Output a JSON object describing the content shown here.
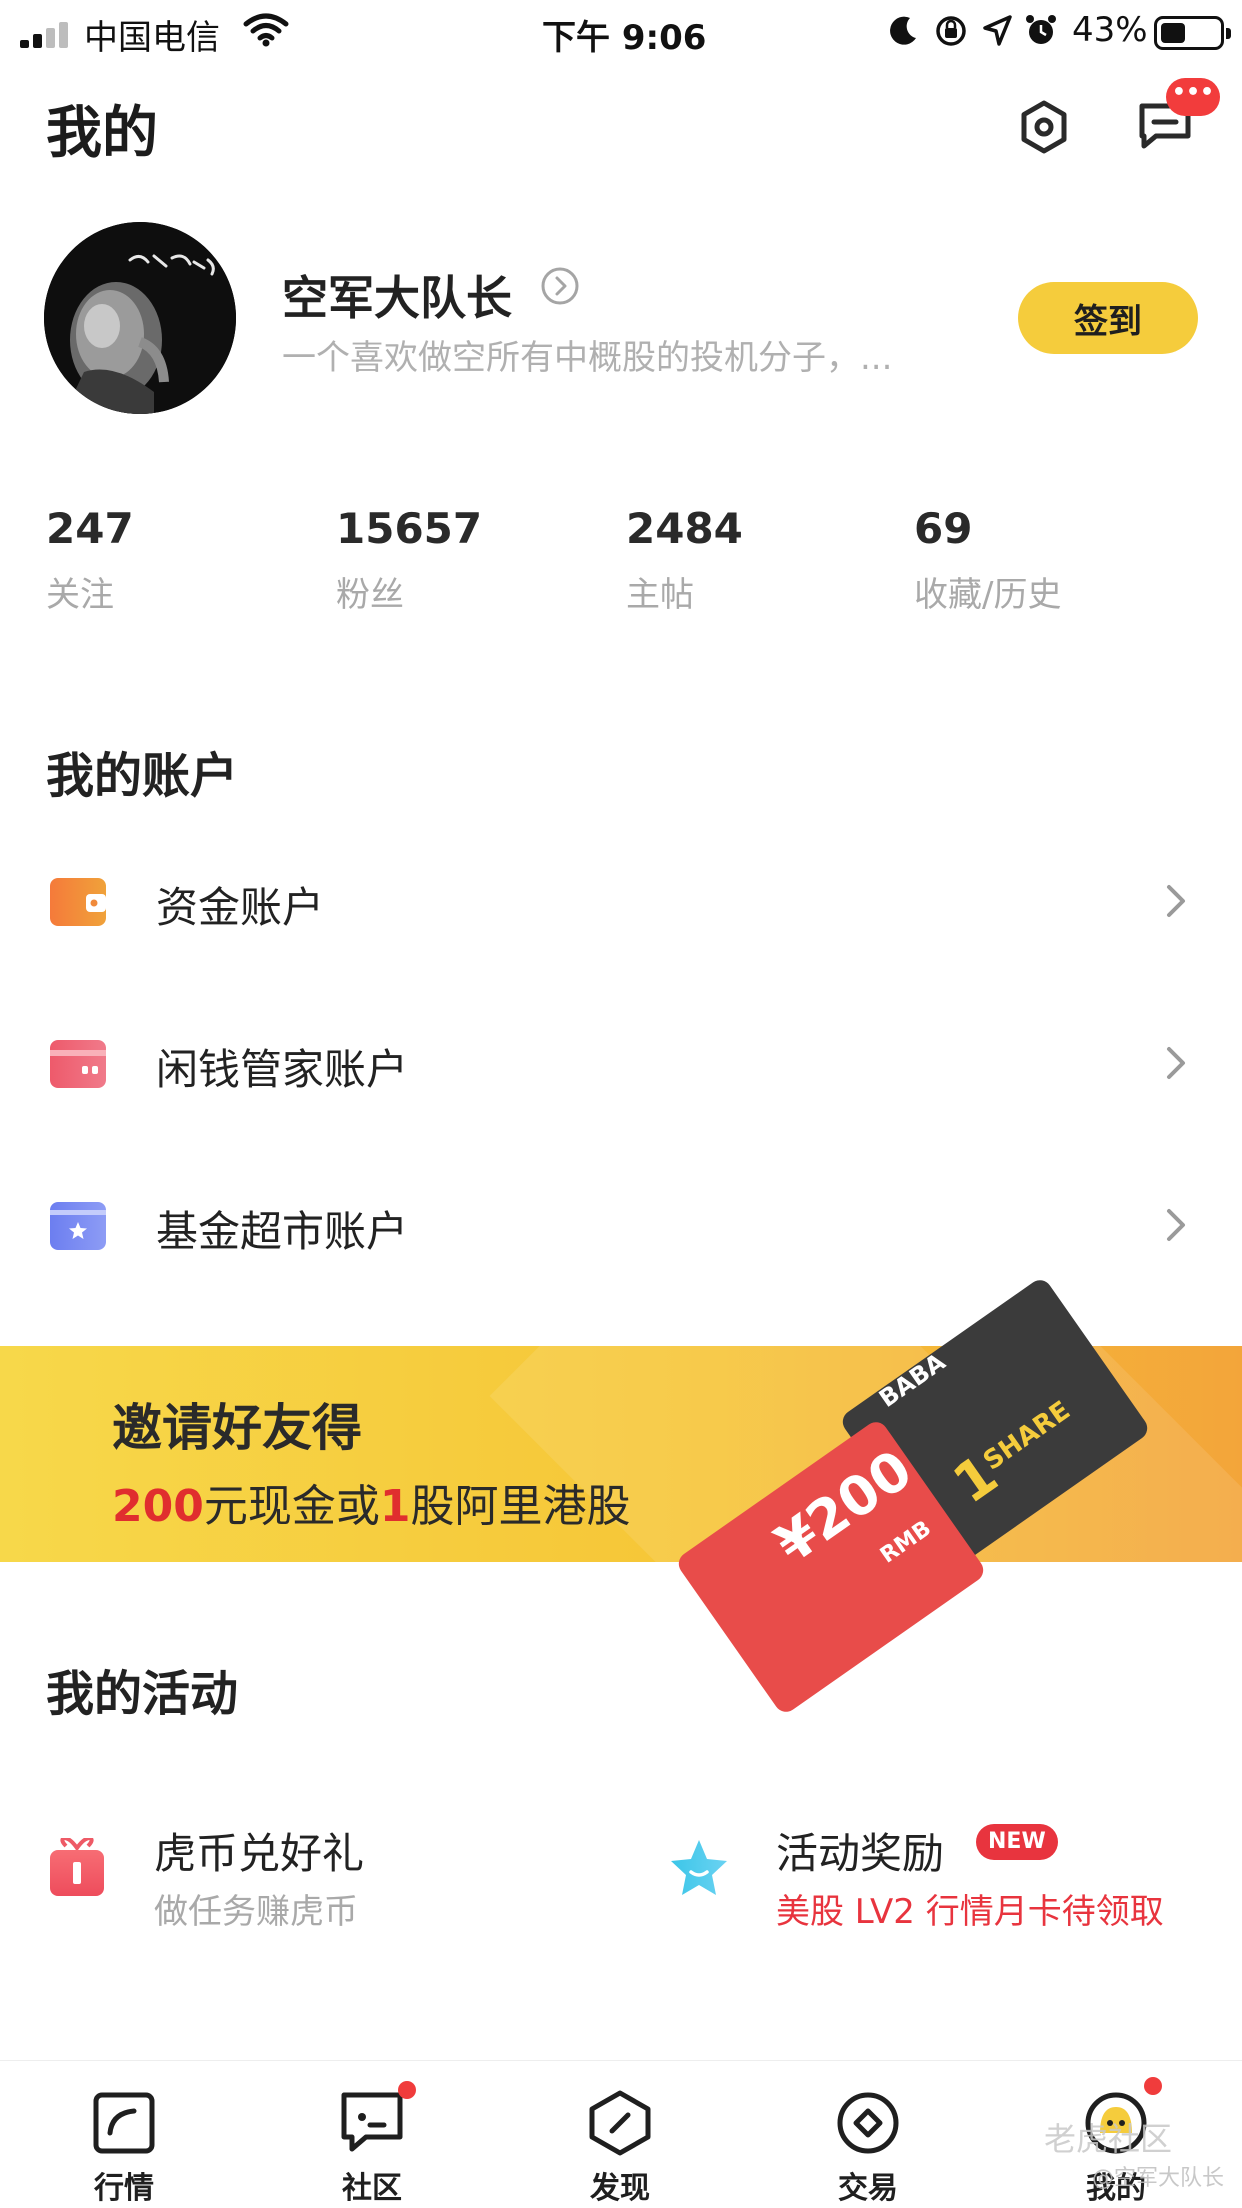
{
  "status_bar": {
    "carrier": "中国电信",
    "time": "下午 9:06",
    "battery": "43%"
  },
  "header": {
    "title": "我的",
    "message_badge": "•••"
  },
  "profile": {
    "name": "空军大队长",
    "bio": "一个喜欢做空所有中概股的投机分子，...",
    "checkin_label": "签到"
  },
  "stats": [
    {
      "value": "247",
      "label": "关注"
    },
    {
      "value": "15657",
      "label": "粉丝"
    },
    {
      "value": "2484",
      "label": "主帖"
    },
    {
      "value": "69",
      "label": "收藏/历史"
    }
  ],
  "accounts": {
    "title": "我的账户",
    "items": [
      {
        "label": "资金账户",
        "icon": "wallet-icon",
        "color": "#f06a3c"
      },
      {
        "label": "闲钱管家账户",
        "icon": "card-icon",
        "color": "#ee5a6b"
      },
      {
        "label": "基金超市账户",
        "icon": "fund-icon",
        "color": "#6f88f2"
      }
    ]
  },
  "banner": {
    "title": "邀请好友得",
    "sub_amount": "200",
    "sub_mid": "元现金或",
    "sub_count": "1",
    "sub_end": "股阿里港股",
    "card_red_amount": "¥200",
    "card_red_unit": "RMB",
    "card_dark_ticker": "BABA",
    "card_dark_count": "1",
    "card_dark_unit": "SHARE"
  },
  "activities": {
    "title": "我的活动",
    "items": [
      {
        "title": "虎币兑好礼",
        "subtitle": "做任务赚虎币",
        "icon": "gift-icon"
      },
      {
        "title": "活动奖励",
        "badge": "NEW",
        "subtitle": "美股 LV2 行情月卡待领取",
        "icon": "star-icon"
      }
    ]
  },
  "tabs": [
    {
      "label": "行情",
      "icon": "market-icon"
    },
    {
      "label": "社区",
      "icon": "community-icon"
    },
    {
      "label": "发现",
      "icon": "discover-icon"
    },
    {
      "label": "交易",
      "icon": "trade-icon"
    },
    {
      "label": "我的",
      "icon": "profile-tab-icon"
    }
  ],
  "watermark": {
    "line1": "老虎社区",
    "line2": "@空军大队长"
  },
  "colors": {
    "accent_yellow": "#f5cc3c",
    "alert_red": "#e8343e"
  }
}
